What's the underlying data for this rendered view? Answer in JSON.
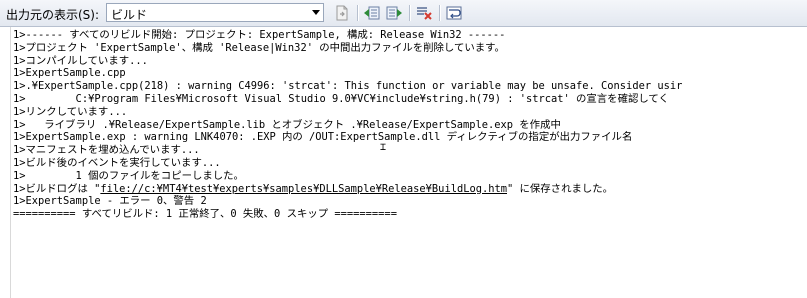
{
  "toolbar": {
    "show_output_from_label": "出力元の表示(S):",
    "source_selected": "ビルド",
    "buttons": [
      {
        "icon": "find-source-icon"
      },
      {
        "icon": "prev-message-icon"
      },
      {
        "icon": "next-message-icon"
      },
      {
        "icon": "clear-all-icon"
      },
      {
        "icon": "word-wrap-icon"
      }
    ]
  },
  "output": {
    "lines": [
      {
        "text": "1>------ すべてのリビルド開始: プロジェクト: ExpertSample, 構成: Release Win32 ------"
      },
      {
        "text": "1>プロジェクト 'ExpertSample'、構成 'Release|Win32' の中間出力ファイルを削除しています。"
      },
      {
        "text": "1>コンパイルしています..."
      },
      {
        "text": "1>ExpertSample.cpp"
      },
      {
        "text": "1>.¥ExpertSample.cpp(218) : warning C4996: 'strcat': This function or variable may be unsafe. Consider usir"
      },
      {
        "text": "1>        C:¥Program Files¥Microsoft Visual Studio 9.0¥VC¥include¥string.h(79) : 'strcat' の宣言を確認してく"
      },
      {
        "text": "1>リンクしています..."
      },
      {
        "text": "1>   ライブラリ .¥Release/ExpertSample.lib とオブジェクト .¥Release/ExpertSample.exp を作成中"
      },
      {
        "text": "1>ExpertSample.exp : warning LNK4070: .EXP 内の /OUT:ExpertSample.dll ディレクティブの指定が出力ファイル名"
      },
      {
        "text": "1>マニフェストを埋め込んでいます..."
      },
      {
        "text": "1>ビルド後のイベントを実行しています..."
      },
      {
        "text": "1>        1 個のファイルをコピーしました。"
      },
      {
        "prefix": "1>ビルドログは \"",
        "link": "file://c:¥MT4¥test¥experts¥samples¥DLLSample¥Release¥BuildLog.htm",
        "suffix": "\" に保存されました。"
      },
      {
        "text": "1>ExpertSample - エラー 0、警告 2"
      },
      {
        "text": "========== すべてリビルド: 1 正常終了、0 失敗、0 スキップ =========="
      }
    ]
  }
}
